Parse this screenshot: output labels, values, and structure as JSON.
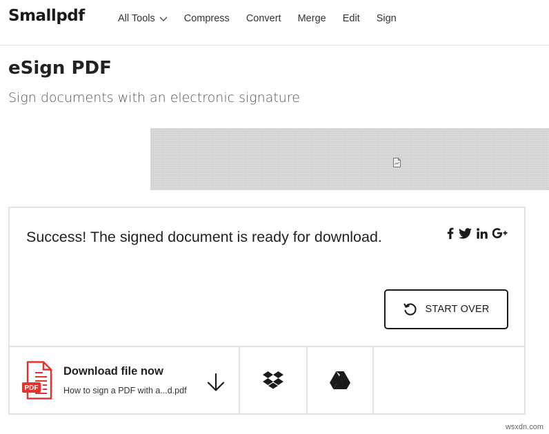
{
  "brand": {
    "logo": "Smallpdf"
  },
  "nav": {
    "items": [
      {
        "label": "All Tools",
        "has_dropdown": true
      },
      {
        "label": "Compress"
      },
      {
        "label": "Convert"
      },
      {
        "label": "Merge"
      },
      {
        "label": "Edit"
      },
      {
        "label": "Sign"
      }
    ]
  },
  "page": {
    "title": "eSign PDF",
    "subtitle": "Sign documents with an electronic signature"
  },
  "ad": {
    "icon": "broken-image-icon"
  },
  "result": {
    "message": "Success! The signed document is ready for download.",
    "share_icons": [
      "facebook-icon",
      "twitter-icon",
      "linkedin-icon",
      "google-plus-icon"
    ],
    "start_over_label": "START OVER",
    "start_over_icon": "restart-icon",
    "download": {
      "title": "Download file now",
      "filename": "How to sign a PDF with a...d.pdf",
      "file_icon": "pdf-file-icon",
      "action_icon": "download-arrow-icon"
    },
    "cloud_targets": [
      "dropbox-icon",
      "google-drive-icon"
    ]
  },
  "colors": {
    "pdf_red": "#e5322d",
    "border": "#e3e3e3",
    "ad_bg": "#d9d9d9"
  },
  "watermark": "wsxdn.com"
}
